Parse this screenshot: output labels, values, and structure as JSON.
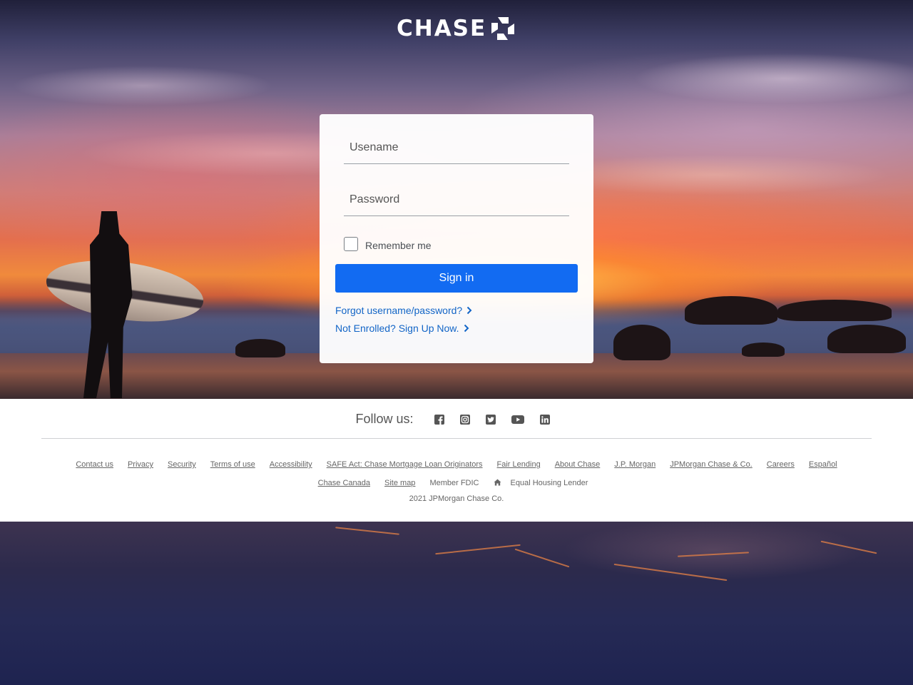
{
  "brand": {
    "name": "CHASE"
  },
  "login": {
    "username_placeholder": "Usename",
    "password_placeholder": "Password",
    "remember_label": "Remember me",
    "signin_label": "Sign in",
    "forgot_link": "Forgot username/password?",
    "enroll_link": "Not Enrolled? Sign Up Now."
  },
  "footer": {
    "follow_label": "Follow us:",
    "social_icons": [
      "facebook-icon",
      "instagram-icon",
      "twitter-icon",
      "youtube-icon",
      "linkedin-icon"
    ],
    "links_row1": [
      "Contact us",
      "Privacy",
      "Security",
      "Terms of use",
      "Accessibility",
      "SAFE Act: Chase Mortgage Loan Originators",
      "Fair Lending",
      "About Chase",
      "J.P. Morgan",
      "JPMorgan Chase & Co.",
      "Careers",
      "Español"
    ],
    "links_row2": [
      "Chase Canada",
      "Site map"
    ],
    "member_fdic": "Member FDIC",
    "equal_housing": "Equal Housing Lender",
    "copyright": "2021 JPMorgan Chase Co."
  },
  "colors": {
    "primary_button": "#126bf2",
    "link": "#1265c7"
  }
}
